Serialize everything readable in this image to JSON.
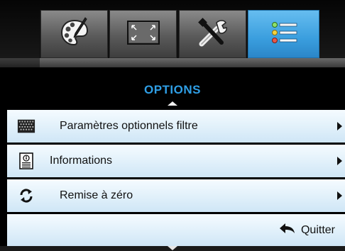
{
  "header": {
    "title": "OPTIONS"
  },
  "tabs": [
    {
      "icon": "palette-icon",
      "active": false
    },
    {
      "icon": "screen-resize-icon",
      "active": false
    },
    {
      "icon": "tools-icon",
      "active": false
    },
    {
      "icon": "list-options-icon",
      "active": true
    }
  ],
  "menu": {
    "items": [
      {
        "label": "Paramètres optionnels filtre",
        "icon": "filter-grid-icon"
      },
      {
        "label": "Informations",
        "icon": "info-document-icon"
      },
      {
        "label": "Remise à zéro",
        "icon": "reset-arrows-icon"
      }
    ],
    "quit_label": "Quitter",
    "quit_icon": "back-arrow-icon"
  },
  "colors": {
    "accent": "#2f9fe6",
    "active_tab": "#3a9ede",
    "row_bg": "#e4f2fb"
  }
}
